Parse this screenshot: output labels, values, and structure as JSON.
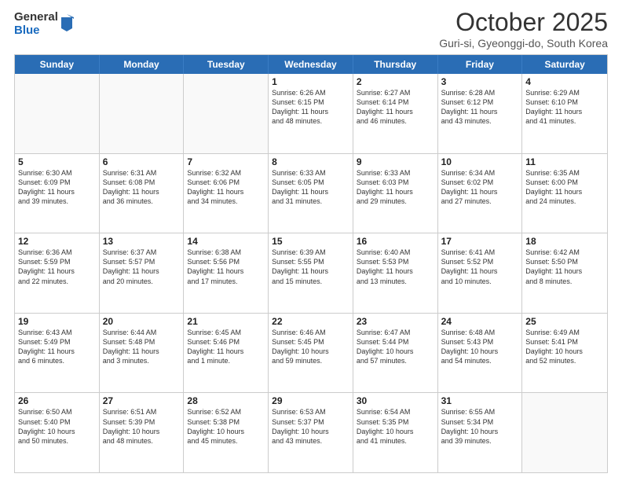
{
  "logo": {
    "general": "General",
    "blue": "Blue"
  },
  "title": "October 2025",
  "subtitle": "Guri-si, Gyeonggi-do, South Korea",
  "headers": [
    "Sunday",
    "Monday",
    "Tuesday",
    "Wednesday",
    "Thursday",
    "Friday",
    "Saturday"
  ],
  "rows": [
    [
      {
        "day": "",
        "text": ""
      },
      {
        "day": "",
        "text": ""
      },
      {
        "day": "",
        "text": ""
      },
      {
        "day": "1",
        "text": "Sunrise: 6:26 AM\nSunset: 6:15 PM\nDaylight: 11 hours\nand 48 minutes."
      },
      {
        "day": "2",
        "text": "Sunrise: 6:27 AM\nSunset: 6:14 PM\nDaylight: 11 hours\nand 46 minutes."
      },
      {
        "day": "3",
        "text": "Sunrise: 6:28 AM\nSunset: 6:12 PM\nDaylight: 11 hours\nand 43 minutes."
      },
      {
        "day": "4",
        "text": "Sunrise: 6:29 AM\nSunset: 6:10 PM\nDaylight: 11 hours\nand 41 minutes."
      }
    ],
    [
      {
        "day": "5",
        "text": "Sunrise: 6:30 AM\nSunset: 6:09 PM\nDaylight: 11 hours\nand 39 minutes."
      },
      {
        "day": "6",
        "text": "Sunrise: 6:31 AM\nSunset: 6:08 PM\nDaylight: 11 hours\nand 36 minutes."
      },
      {
        "day": "7",
        "text": "Sunrise: 6:32 AM\nSunset: 6:06 PM\nDaylight: 11 hours\nand 34 minutes."
      },
      {
        "day": "8",
        "text": "Sunrise: 6:33 AM\nSunset: 6:05 PM\nDaylight: 11 hours\nand 31 minutes."
      },
      {
        "day": "9",
        "text": "Sunrise: 6:33 AM\nSunset: 6:03 PM\nDaylight: 11 hours\nand 29 minutes."
      },
      {
        "day": "10",
        "text": "Sunrise: 6:34 AM\nSunset: 6:02 PM\nDaylight: 11 hours\nand 27 minutes."
      },
      {
        "day": "11",
        "text": "Sunrise: 6:35 AM\nSunset: 6:00 PM\nDaylight: 11 hours\nand 24 minutes."
      }
    ],
    [
      {
        "day": "12",
        "text": "Sunrise: 6:36 AM\nSunset: 5:59 PM\nDaylight: 11 hours\nand 22 minutes."
      },
      {
        "day": "13",
        "text": "Sunrise: 6:37 AM\nSunset: 5:57 PM\nDaylight: 11 hours\nand 20 minutes."
      },
      {
        "day": "14",
        "text": "Sunrise: 6:38 AM\nSunset: 5:56 PM\nDaylight: 11 hours\nand 17 minutes."
      },
      {
        "day": "15",
        "text": "Sunrise: 6:39 AM\nSunset: 5:55 PM\nDaylight: 11 hours\nand 15 minutes."
      },
      {
        "day": "16",
        "text": "Sunrise: 6:40 AM\nSunset: 5:53 PM\nDaylight: 11 hours\nand 13 minutes."
      },
      {
        "day": "17",
        "text": "Sunrise: 6:41 AM\nSunset: 5:52 PM\nDaylight: 11 hours\nand 10 minutes."
      },
      {
        "day": "18",
        "text": "Sunrise: 6:42 AM\nSunset: 5:50 PM\nDaylight: 11 hours\nand 8 minutes."
      }
    ],
    [
      {
        "day": "19",
        "text": "Sunrise: 6:43 AM\nSunset: 5:49 PM\nDaylight: 11 hours\nand 6 minutes."
      },
      {
        "day": "20",
        "text": "Sunrise: 6:44 AM\nSunset: 5:48 PM\nDaylight: 11 hours\nand 3 minutes."
      },
      {
        "day": "21",
        "text": "Sunrise: 6:45 AM\nSunset: 5:46 PM\nDaylight: 11 hours\nand 1 minute."
      },
      {
        "day": "22",
        "text": "Sunrise: 6:46 AM\nSunset: 5:45 PM\nDaylight: 10 hours\nand 59 minutes."
      },
      {
        "day": "23",
        "text": "Sunrise: 6:47 AM\nSunset: 5:44 PM\nDaylight: 10 hours\nand 57 minutes."
      },
      {
        "day": "24",
        "text": "Sunrise: 6:48 AM\nSunset: 5:43 PM\nDaylight: 10 hours\nand 54 minutes."
      },
      {
        "day": "25",
        "text": "Sunrise: 6:49 AM\nSunset: 5:41 PM\nDaylight: 10 hours\nand 52 minutes."
      }
    ],
    [
      {
        "day": "26",
        "text": "Sunrise: 6:50 AM\nSunset: 5:40 PM\nDaylight: 10 hours\nand 50 minutes."
      },
      {
        "day": "27",
        "text": "Sunrise: 6:51 AM\nSunset: 5:39 PM\nDaylight: 10 hours\nand 48 minutes."
      },
      {
        "day": "28",
        "text": "Sunrise: 6:52 AM\nSunset: 5:38 PM\nDaylight: 10 hours\nand 45 minutes."
      },
      {
        "day": "29",
        "text": "Sunrise: 6:53 AM\nSunset: 5:37 PM\nDaylight: 10 hours\nand 43 minutes."
      },
      {
        "day": "30",
        "text": "Sunrise: 6:54 AM\nSunset: 5:35 PM\nDaylight: 10 hours\nand 41 minutes."
      },
      {
        "day": "31",
        "text": "Sunrise: 6:55 AM\nSunset: 5:34 PM\nDaylight: 10 hours\nand 39 minutes."
      },
      {
        "day": "",
        "text": ""
      }
    ]
  ]
}
